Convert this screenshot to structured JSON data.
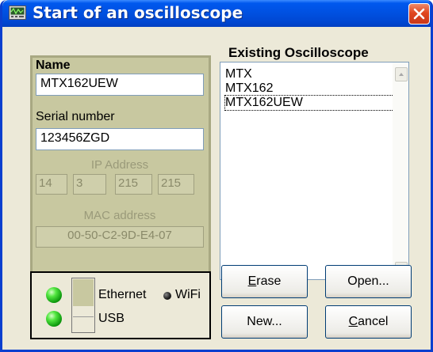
{
  "window": {
    "title": "Start of an oscilloscope",
    "title_icon": "oscilloscope-icon",
    "close_icon": "close-icon"
  },
  "identity": {
    "name_label": "Name",
    "name_value": "MTX162UEW",
    "serial_label": "Serial number",
    "serial_value": "123456ZGD",
    "ip_label": "IP Address",
    "ip_parts": [
      "14",
      "3",
      "215",
      "215"
    ],
    "mac_label": "MAC address",
    "mac_value": "00-50-C2-9D-E4-07"
  },
  "list": {
    "title": "Existing Oscilloscope",
    "items": [
      "MTX",
      "MTX162",
      "MTX162UEW"
    ],
    "selected_index": 2
  },
  "connection": {
    "ethernet_label": "Ethernet",
    "usb_label": "USB",
    "wifi_label": "WiFi",
    "selected": "Ethernet",
    "led_color": "#2ec82e"
  },
  "buttons": {
    "erase": {
      "mnemonic": "E",
      "rest": "rase"
    },
    "open": "Open...",
    "new": "New...",
    "cancel": {
      "mnemonic": "C",
      "rest": "ancel"
    }
  },
  "colors": {
    "titlebar": "#0054e3",
    "panel": "#c8c8a0",
    "dialog": "#ece9d8",
    "close": "#e0461f"
  }
}
